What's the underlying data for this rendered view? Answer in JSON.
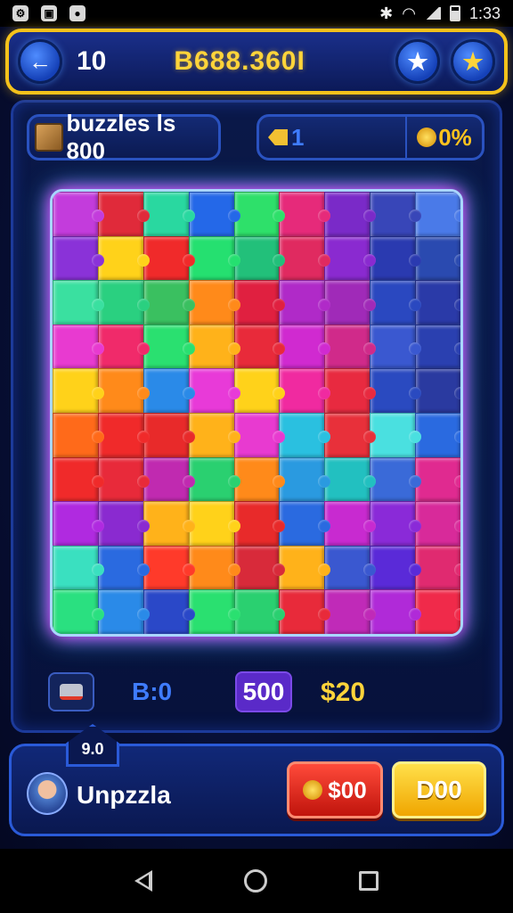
{
  "status_bar": {
    "time": "1:33"
  },
  "header": {
    "level": "10",
    "score": "B688.360I",
    "back_icon": "arrow-left-icon",
    "star_icons": [
      "star-icon",
      "star-icon"
    ]
  },
  "info": {
    "puzzles_label": "buzzles ls 800",
    "progress_value": "1",
    "coins_percent": "0%"
  },
  "board": {
    "columns": 9,
    "rows": 10,
    "colors": [
      "#c33cdc",
      "#e02a3a",
      "#29d8a0",
      "#2468e8",
      "#2ee06a",
      "#e62a7a",
      "#7a2ac8",
      "#3846b8",
      "#4a7ae8",
      "#8a32d8",
      "#ffd21a",
      "#f02a2a",
      "#25e070",
      "#22c07a",
      "#e02a60",
      "#8a2ad0",
      "#2a3ab0",
      "#2a4ab0",
      "#3ae0a0",
      "#2ad080",
      "#3ac060",
      "#ff8a1a",
      "#e02040",
      "#b02ac8",
      "#a02ab8",
      "#2a48c0",
      "#2a3aa8",
      "#e83ad0",
      "#f02a6a",
      "#2ae070",
      "#ffb21a",
      "#e82a3a",
      "#d02ad0",
      "#d02a8a",
      "#3a58d0",
      "#2a40b0",
      "#ffd21a",
      "#ff8a1a",
      "#2a8ae8",
      "#e83ad8",
      "#ffd21a",
      "#f02aa0",
      "#e82a40",
      "#2a4ac0",
      "#2a3aa0",
      "#ff6a1a",
      "#f02a2a",
      "#e82a2a",
      "#ffb21a",
      "#e83ad0",
      "#2ac0e0",
      "#e8303a",
      "#4ae0e0",
      "#2a6ae0",
      "#f02a2a",
      "#e82a3a",
      "#c02ab0",
      "#2ad070",
      "#ff8a1a",
      "#2a9ae0",
      "#22c0c0",
      "#3a6ad8",
      "#e02a90",
      "#b02ae0",
      "#8a2ad0",
      "#ffb21a",
      "#ffd21a",
      "#e82a2a",
      "#2a6ae0",
      "#c82ad0",
      "#8a2ad8",
      "#d82a9a",
      "#3ae0c0",
      "#2a6ae0",
      "#ff3a2a",
      "#ff8a1a",
      "#d82a3a",
      "#ffb21a",
      "#3a58d0",
      "#5a2ad8",
      "#e02a70",
      "#2ae080",
      "#2a8ae8",
      "#2a48c8",
      "#2ae070",
      "#2ad070",
      "#e82a3a",
      "#c02ab8",
      "#b02ad8",
      "#f02a4a"
    ]
  },
  "stats": {
    "timer": "B:0",
    "moves": "500",
    "money": "$20"
  },
  "player": {
    "badge": "9.0",
    "name": "Unpzzla"
  },
  "buttons": {
    "red_label": "$00",
    "gold_label": "D00"
  }
}
